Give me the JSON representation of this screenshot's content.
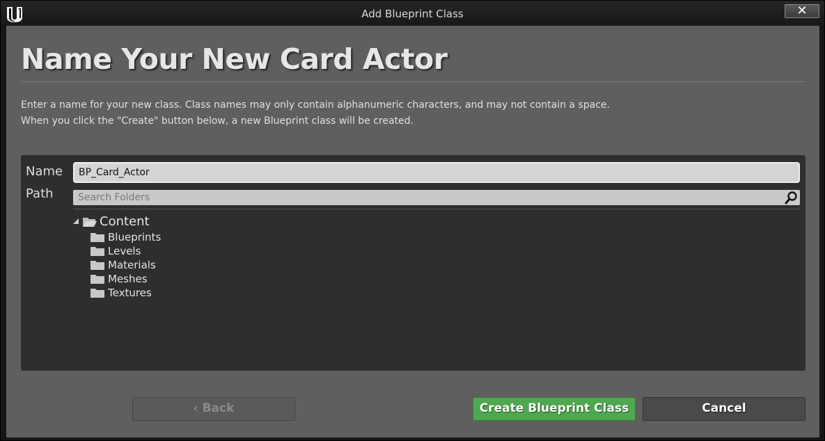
{
  "window": {
    "title": "Add Blueprint Class",
    "close_label": "✕",
    "logo_icon": "unreal-logo-icon"
  },
  "dialog": {
    "heading": "Name Your New Card Actor",
    "description_line1": "Enter a name for your new class. Class names may only contain alphanumeric characters, and may not contain a space.",
    "description_line2": "When you click the \"Create\" button below, a new Blueprint class will be created."
  },
  "form": {
    "name_label": "Name",
    "name_value": "BP_Card_Actor",
    "path_label": "Path",
    "search_placeholder": "Search Folders",
    "search_icon": "search-icon"
  },
  "tree": {
    "root": {
      "label": "Content",
      "expanded": true
    },
    "children": [
      {
        "label": "Blueprints"
      },
      {
        "label": "Levels"
      },
      {
        "label": "Materials"
      },
      {
        "label": "Meshes"
      },
      {
        "label": "Textures"
      }
    ]
  },
  "buttons": {
    "back_label": "Back",
    "back_arrow": "‹",
    "create_label": "Create Blueprint Class",
    "cancel_label": "Cancel"
  },
  "colors": {
    "content_bg": "#5f5f5f",
    "panel_bg": "#2e2e2e",
    "create_accent": "#4fa84f"
  }
}
